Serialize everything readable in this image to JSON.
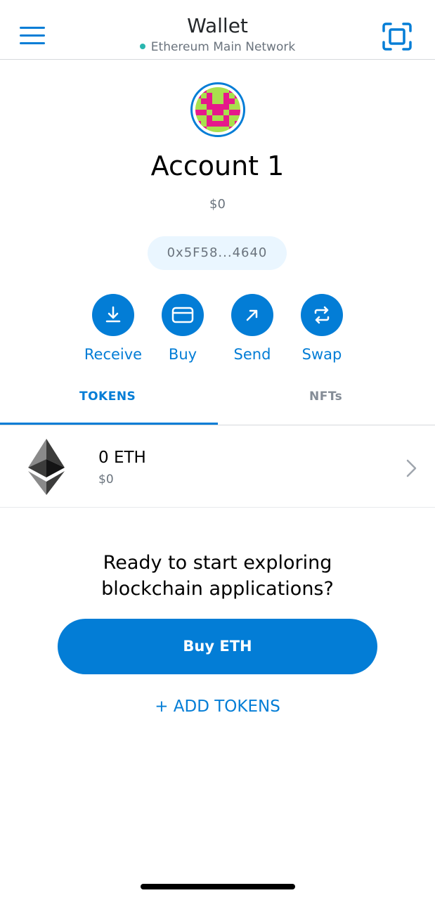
{
  "header": {
    "title": "Wallet",
    "network": "Ethereum Main Network",
    "network_dot_color": "#29b6af",
    "menu_icon": "hamburger-icon",
    "scan_icon": "qr-scan-icon"
  },
  "account": {
    "name": "Account 1",
    "balance": "$0",
    "address": "0x5F58...4640",
    "avatar_icon": "identicon-avatar"
  },
  "actions": [
    {
      "label": "Receive",
      "icon": "download-arrow-icon"
    },
    {
      "label": "Buy",
      "icon": "credit-card-icon"
    },
    {
      "label": "Send",
      "icon": "arrow-up-right-icon"
    },
    {
      "label": "Swap",
      "icon": "swap-arrows-icon"
    }
  ],
  "tabs": {
    "tokens": "TOKENS",
    "nfts": "NFTs",
    "active": "tokens"
  },
  "token": {
    "amount": "0 ETH",
    "fiat": "$0",
    "icon": "ethereum-logo-icon"
  },
  "cta": {
    "line1": "Ready to start exploring",
    "line2": "blockchain applications?",
    "button": "Buy ETH",
    "add_tokens": "+ ADD TOKENS"
  },
  "colors": {
    "accent": "#037dd6",
    "muted": "#6a737d",
    "address_bg": "#eaf6ff"
  }
}
